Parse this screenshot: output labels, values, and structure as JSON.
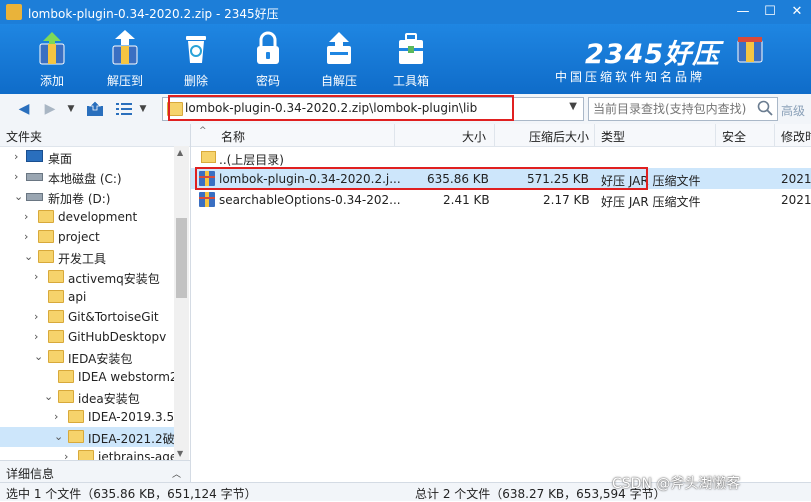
{
  "window": {
    "title": "lombok-plugin-0.34-2020.2.zip - 2345好压",
    "minimize": "—",
    "maximize": "☐",
    "close": "✕"
  },
  "toolbar": {
    "items": [
      {
        "label": "添加",
        "icon": "add-archive-icon"
      },
      {
        "label": "解压到",
        "icon": "extract-icon"
      },
      {
        "label": "删除",
        "icon": "trash-icon"
      },
      {
        "label": "密码",
        "icon": "lock-icon"
      },
      {
        "label": "自解压",
        "icon": "self-extract-icon"
      },
      {
        "label": "工具箱",
        "icon": "toolbox-icon"
      }
    ],
    "brand_logo": "2345好压",
    "brand_slogan": "中国压缩软件知名品牌"
  },
  "address": {
    "path": "lombok-plugin-0.34-2020.2.zip\\lombok-plugin\\lib",
    "search_placeholder": "当前目录查找(支持包内查找)",
    "advanced": "高级"
  },
  "sidebar": {
    "header": "文件夹",
    "items": [
      {
        "label": "桌面",
        "type": "desktop"
      },
      {
        "label": "本地磁盘 (C:)",
        "type": "drive"
      },
      {
        "label": "新加卷 (D:)",
        "type": "drive"
      },
      {
        "label": "development",
        "type": "folder"
      },
      {
        "label": "project",
        "type": "folder"
      },
      {
        "label": "开发工具",
        "type": "folder"
      },
      {
        "label": "activemq安装包",
        "type": "folder"
      },
      {
        "label": "api",
        "type": "folder"
      },
      {
        "label": "Git&TortoiseGit",
        "type": "folder"
      },
      {
        "label": "GitHubDesktopv",
        "type": "folder"
      },
      {
        "label": "IEDA安装包",
        "type": "folder"
      },
      {
        "label": "IDEA webstorm2",
        "type": "folder"
      },
      {
        "label": "idea安装包",
        "type": "folder"
      },
      {
        "label": "IDEA-2019.3.5i",
        "type": "folder"
      },
      {
        "label": "IDEA-2021.2破",
        "type": "folder"
      },
      {
        "label": "jetbrains-age",
        "type": "folder"
      }
    ],
    "details_label": "详细信息"
  },
  "filelist": {
    "columns": [
      "名称",
      "大小",
      "压缩后大小",
      "类型",
      "安全",
      "修改时"
    ],
    "rows": [
      {
        "name": "..(上层目录)",
        "size": "",
        "packed": "",
        "type": "",
        "security": "",
        "modified": ""
      },
      {
        "name": "lombok-plugin-0.34-2020.2.j...",
        "size": "635.86 KB",
        "packed": "571.25 KB",
        "type": "好压 JAR 压缩文件",
        "security": "",
        "modified": "2021-"
      },
      {
        "name": "searchableOptions-0.34-202...",
        "size": "2.41 KB",
        "packed": "2.17 KB",
        "type": "好压 JAR 压缩文件",
        "security": "",
        "modified": "2021-"
      }
    ]
  },
  "status": {
    "left": "选中 1 个文件（635.86 KB，651,124 字节）",
    "right": "总计 2 个文件（638.27 KB，653,594 字节）"
  },
  "watermark": "CSDN @斧头湖懒客",
  "colors": {
    "accent": "#1d7ed8",
    "selection": "#cde6fb",
    "highlight": "#e02020"
  }
}
